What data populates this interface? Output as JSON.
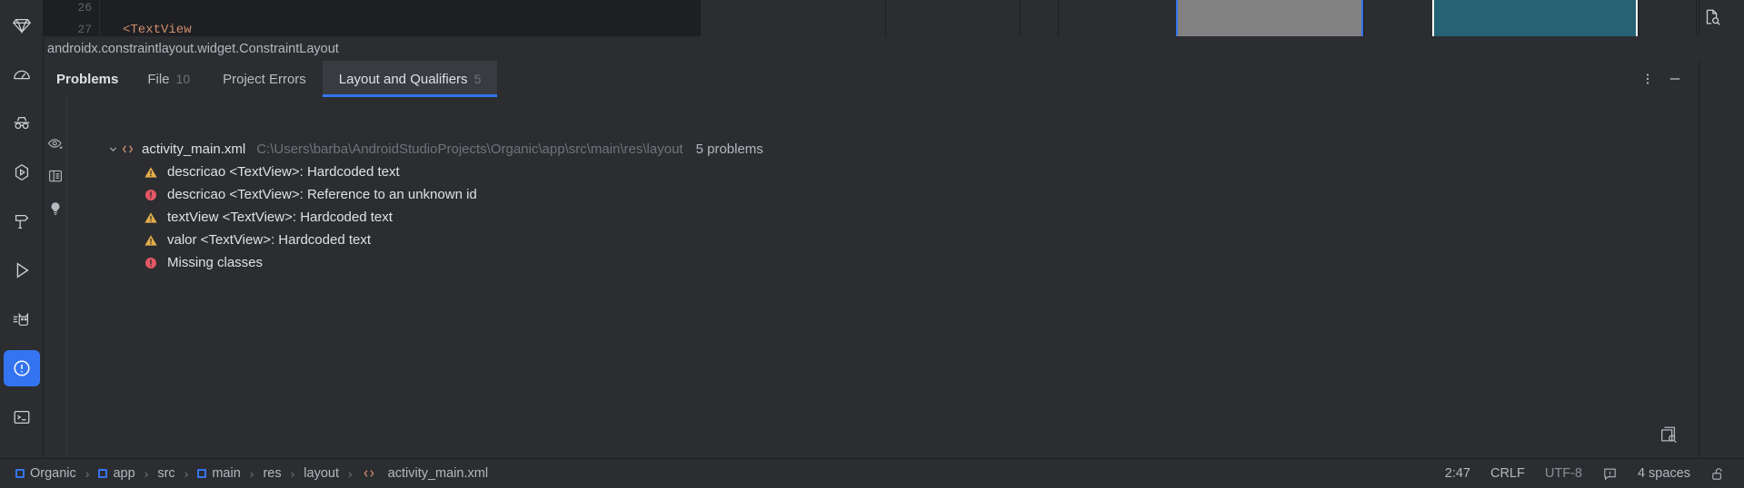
{
  "window": {
    "background": "#2b2d30",
    "accent": "#3574f0"
  },
  "activity_bar": {
    "items": [
      {
        "name": "gem-icon",
        "icon": "gem",
        "selected": false
      },
      {
        "name": "gauge-icon",
        "icon": "gauge",
        "selected": false
      },
      {
        "name": "incognito-icon",
        "icon": "incognito",
        "selected": false
      },
      {
        "name": "build-run-icon",
        "icon": "hex-play",
        "selected": false
      },
      {
        "name": "build-hammer-icon",
        "icon": "hammer",
        "selected": false
      },
      {
        "name": "run-icon",
        "icon": "play",
        "selected": false
      },
      {
        "name": "logcat-icon",
        "icon": "cat",
        "selected": false
      },
      {
        "name": "problems-icon",
        "icon": "warning-circle",
        "selected": true
      },
      {
        "name": "terminal-icon",
        "icon": "terminal",
        "selected": false
      },
      {
        "name": "version-control-icon",
        "icon": "branch",
        "selected": false
      }
    ]
  },
  "editor": {
    "line_numbers": [
      "26",
      "27"
    ],
    "code_line": "<TextView",
    "code_color": "#cf8e6d",
    "preview_gray_color": "#818181",
    "preview_teal_color": "#256275",
    "selection_border": "#3574f0",
    "white_border": "#ffffff"
  },
  "component_bar": {
    "label": "androidx.constraintlayout.widget.ConstraintLayout"
  },
  "problems_panel": {
    "title": "Problems",
    "tabs": [
      {
        "label": "File",
        "count": "10",
        "active": false
      },
      {
        "label": "Project Errors",
        "count": "",
        "active": false
      },
      {
        "label": "Layout and Qualifiers",
        "count": "5",
        "active": true
      }
    ],
    "actions": [
      {
        "name": "more-options-icon",
        "icon": "kebab"
      },
      {
        "name": "minimize-icon",
        "icon": "minus"
      }
    ],
    "gutter_icons": [
      {
        "name": "preview-eye-icon",
        "icon": "eye-dropdown"
      },
      {
        "name": "group-by-icon",
        "icon": "panel"
      },
      {
        "name": "quick-fix-bulb-icon",
        "icon": "bulb"
      }
    ],
    "tree": {
      "file": {
        "name": "activity_main.xml",
        "path": "C:\\Users\\barba\\AndroidStudioProjects\\Organic\\app\\src\\main\\res\\layout",
        "count": "5 problems",
        "expanded": true
      },
      "problems": [
        {
          "severity": "warning",
          "text": "descricao <TextView>: Hardcoded text"
        },
        {
          "severity": "error",
          "text": "descricao <TextView>: Reference to an unknown id"
        },
        {
          "severity": "warning",
          "text": "textView <TextView>: Hardcoded text"
        },
        {
          "severity": "warning",
          "text": "valor <TextView>: Hardcoded text"
        },
        {
          "severity": "error",
          "text": "Missing classes"
        }
      ]
    }
  },
  "status_bar": {
    "breadcrumbs": [
      {
        "label": "Organic",
        "icon": "module"
      },
      {
        "label": "app",
        "icon": "module"
      },
      {
        "label": "src",
        "icon": "none"
      },
      {
        "label": "main",
        "icon": "module"
      },
      {
        "label": "res",
        "icon": "none"
      },
      {
        "label": "layout",
        "icon": "none"
      },
      {
        "label": "activity_main.xml",
        "icon": "xml"
      }
    ],
    "separator": "›",
    "caret_position": "2:47",
    "line_separator": "CRLF",
    "encoding": "UTF-8",
    "indent": "4 spaces",
    "inspection_icon": "inspection",
    "lock_icon": "unlocked-padlock"
  },
  "right_icons": [
    {
      "name": "file-preview-search-icon",
      "icon": "doc-search"
    },
    {
      "name": "layout-preview-search-icon",
      "icon": "layers-search"
    }
  ],
  "severity_colors": {
    "warning": "#e3ae4a",
    "error": "#e55765"
  }
}
